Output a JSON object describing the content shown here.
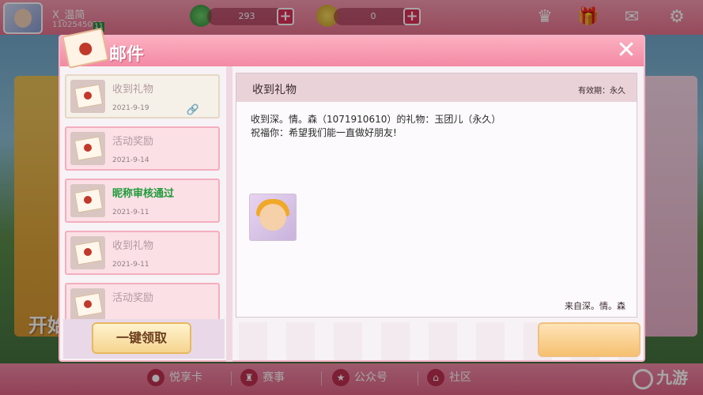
{
  "topbar": {
    "username": "X_温简",
    "user_id": "1102545090",
    "level": "11",
    "resource1": "293",
    "resource2": "0"
  },
  "background": {
    "left_text": "开始",
    "left_text2": "开始"
  },
  "dialog": {
    "title": "邮件",
    "mails": [
      {
        "title": "收到礼物",
        "date": "2021-9-19",
        "selected": true,
        "attachment": true
      },
      {
        "title": "活动奖励",
        "date": "2021-9-14"
      },
      {
        "title": "昵称审核通过",
        "date": "2021-9-11",
        "highlight": true
      },
      {
        "title": "收到礼物",
        "date": "2021-9-11"
      },
      {
        "title": "活动奖励",
        "date": ""
      }
    ],
    "claim_all": "一键领取",
    "detail": {
      "title": "收到礼物",
      "expiry": "有效期：永久",
      "line1": "收到深。情。森（1071910610）的礼物：玉团儿（永久）",
      "line2": "祝福你：希望我们能一直做好朋友!",
      "sender": "来自深。情。森"
    }
  },
  "bottombar": {
    "items": [
      "悦享卡",
      "赛事",
      "公众号",
      "社区"
    ]
  },
  "watermark": "九游"
}
